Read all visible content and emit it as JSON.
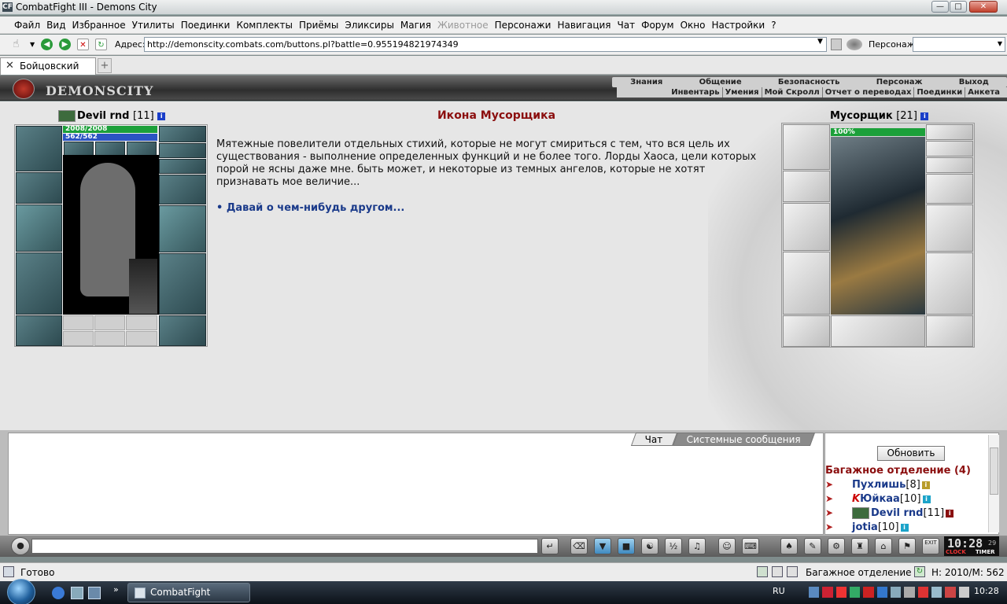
{
  "window": {
    "title": "CombatFight III - Demons City"
  },
  "menu": [
    "Файл",
    "Вид",
    "Избранное",
    "Утилиты",
    "Поединки",
    "Комплекты",
    "Приёмы",
    "Эликсиры",
    "Магия",
    "Животное",
    "Персонажи",
    "Навигация",
    "Чат",
    "Форум",
    "Окно",
    "Настройки",
    "?"
  ],
  "address": {
    "label": "Адрес:",
    "url": "http://demonscity.combats.com/buttons.pl?battle=0.955194821974349",
    "persona_label": "Персонаж:"
  },
  "tabs": [
    {
      "label": "Бойцовский клуб"
    }
  ],
  "game_header": {
    "logo": "DEMONSCITY",
    "top_nav": [
      "Знания",
      "Общение",
      "Безопасность",
      "Персонаж",
      "Выход"
    ],
    "sub_nav": [
      "Инвентарь",
      "Умения",
      "Мой Скролл",
      "Отчет о переводах",
      "Поединки",
      "Анкета"
    ]
  },
  "player": {
    "name": "Devil rnd",
    "level": "[11]",
    "hp": "2008/2008",
    "mana": "562/562"
  },
  "center": {
    "title": "Икона Мусорщика",
    "text": "Мятежные повелители отдельных стихий, которые не могут смириться с тем, что вся цель их существования - выполнение определенных функций и не более того. Лорды Хаоса, цели которых порой не ясны даже мне. быть может, и некоторые из темных ангелов, которые не хотят признавать мое величие...",
    "option": "• Давай о чем-нибудь другом..."
  },
  "opponent": {
    "name": "Мусорщик",
    "level": "[21]",
    "hp": "100%"
  },
  "chat": {
    "tabs": [
      "Чат",
      "Системные сообщения"
    ],
    "refresh_label": "Обновить",
    "room_title": "Багажное отделение (4)",
    "people": [
      {
        "name": "Пухлишь",
        "level": "[8]",
        "info": "i"
      },
      {
        "name": "Юйкаа",
        "level": "[10]",
        "info": "i",
        "prefix": "K"
      },
      {
        "name": "Devil rnd",
        "level": "[11]",
        "info": "i"
      },
      {
        "name": "jotia",
        "level": "[10]",
        "info": "i"
      }
    ]
  },
  "toolbar": {
    "clock": "10:28",
    "clock_sec": "29",
    "clock_label": "CLOCK",
    "timer_label": "TIMER",
    "exit_label": "EXIT"
  },
  "statusbar": {
    "text": "Готово",
    "room": "Багажное отделение",
    "hm": "Н: 2010/М: 562"
  },
  "taskbar": {
    "item": "CombatFight",
    "lang": "RU",
    "time": "10:28"
  },
  "colors": {
    "title_red": "#8b0e0e",
    "link_blue": "#1a3a8a",
    "hp_green": "#1ca03a",
    "mana_blue": "#2b54c2"
  }
}
